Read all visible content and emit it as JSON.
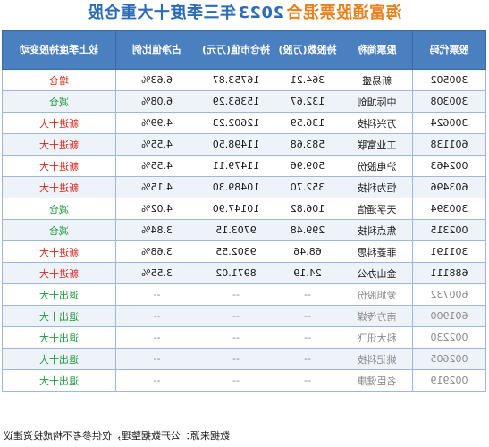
{
  "title": {
    "fund": "海富通股票混合",
    "year": "2023",
    "rest": "年三季度十大重仓股"
  },
  "table": {
    "columns": [
      "股票代码",
      "股票简称",
      "持股数(万股)",
      "持仓市值(万元)",
      "占净值比例",
      "较上季度持股变动"
    ],
    "rows": [
      {
        "code": "300502",
        "name": "新易盛",
        "shares": "364.21",
        "value": "16753.87",
        "pct": "6.63%",
        "change": "增仓",
        "color": "red"
      },
      {
        "code": "300308",
        "name": "中际旭创",
        "shares": "132.67",
        "value": "15363.29",
        "pct": "6.08%",
        "change": "减仓",
        "color": "green"
      },
      {
        "code": "300624",
        "name": "万兴科技",
        "shares": "136.59",
        "value": "12602.23",
        "pct": "4.99%",
        "change": "新进十大",
        "color": "red"
      },
      {
        "code": "601138",
        "name": "工业富联",
        "shares": "583.68",
        "value": "11498.50",
        "pct": "4.55%",
        "change": "新进十大",
        "color": "red"
      },
      {
        "code": "002463",
        "name": "沪电股份",
        "shares": "509.96",
        "value": "11479.11",
        "pct": "4.55%",
        "change": "新进十大",
        "color": "red"
      },
      {
        "code": "603496",
        "name": "恒为科技",
        "shares": "352.70",
        "value": "10489.30",
        "pct": "4.15%",
        "change": "新进十大",
        "color": "red"
      },
      {
        "code": "300394",
        "name": "天孚通信",
        "shares": "106.82",
        "value": "10147.90",
        "pct": "4.02%",
        "change": "减仓",
        "color": "green"
      },
      {
        "code": "002315",
        "name": "焦点科技",
        "shares": "299.48",
        "value": "9703.15",
        "pct": "3.84%",
        "change": "减仓",
        "color": "green"
      },
      {
        "code": "301191",
        "name": "菲菱科思",
        "shares": "68.46",
        "value": "9302.55",
        "pct": "3.68%",
        "change": "新进十大",
        "color": "red"
      },
      {
        "code": "688111",
        "name": "金山办公",
        "shares": "24.19",
        "value": "8971.02",
        "pct": "3.55%",
        "change": "新进十大",
        "color": "red"
      },
      {
        "code": "600732",
        "name": "爱旭股份",
        "shares": "--",
        "value": "--",
        "pct": "--",
        "change": "退出十大",
        "color": "green"
      },
      {
        "code": "601900",
        "name": "南方传媒",
        "shares": "--",
        "value": "--",
        "pct": "--",
        "change": "退出十大",
        "color": "green"
      },
      {
        "code": "002230",
        "name": "科大讯飞",
        "shares": "--",
        "value": "--",
        "pct": "--",
        "change": "退出十大",
        "color": "green"
      },
      {
        "code": "002605",
        "name": "姚记科技",
        "shares": "--",
        "value": "--",
        "pct": "--",
        "change": "退出十大",
        "color": "green"
      },
      {
        "code": "002919",
        "name": "名臣健康",
        "shares": "--",
        "value": "--",
        "pct": "--",
        "change": "退出十大",
        "color": "green"
      }
    ]
  },
  "footer": {
    "source": "数据来源：公开数据整理，仅供参考不构成投资建议"
  }
}
